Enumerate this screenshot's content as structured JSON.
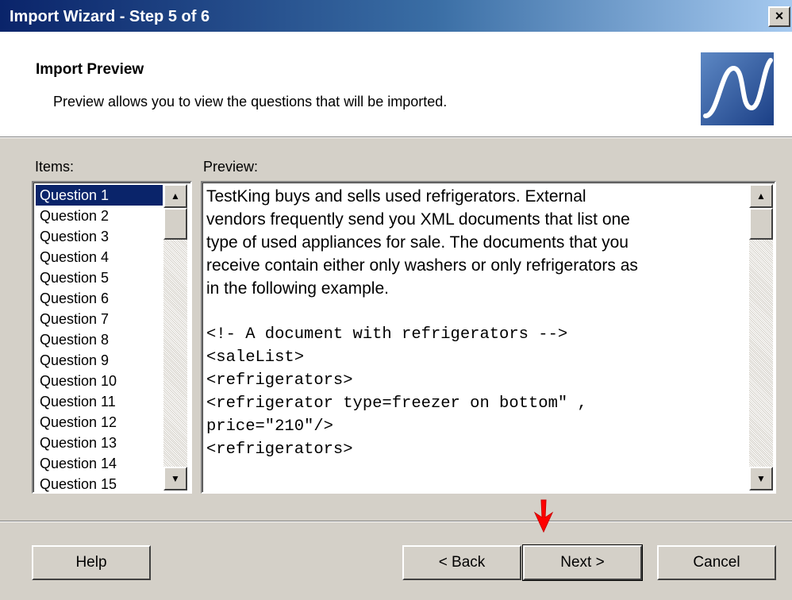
{
  "window": {
    "title": "Import Wizard - Step 5 of 6",
    "close_glyph": "×"
  },
  "header": {
    "title": "Import Preview",
    "subtitle": "Preview allows you to view the questions that will be imported.",
    "logo_icon": "wave-logo-icon"
  },
  "items": {
    "label": "Items:",
    "list": [
      "Question 1",
      "Question 2",
      "Question 3",
      "Question 4",
      "Question 5",
      "Question 6",
      "Question 7",
      "Question 8",
      "Question 9",
      "Question 10",
      "Question 11",
      "Question 12",
      "Question 13",
      "Question 14",
      "Question 15"
    ],
    "selected": "Question 1"
  },
  "preview": {
    "label": "Preview:",
    "paragraph_lines": [
      "TestKing buys and sells used refrigerators. External",
      "vendors frequently send you XML documents that list one",
      "type of used appliances for sale. The documents that you",
      "receive contain either only washers or only refrigerators as",
      "in the following example."
    ],
    "code_lines": [
      "<!- A document with refrigerators -->",
      "<saleList>",
      "<refrigerators>",
      "<refrigerator type=freezer on bottom″ ,",
      "price=″210″/>",
      "<refrigerators>"
    ]
  },
  "scroll_icons": {
    "up": "scroll-up-arrow-icon",
    "down": "scroll-down-arrow-icon"
  },
  "buttons": {
    "help": "Help",
    "back": "< Back",
    "next": "Next >",
    "cancel": "Cancel"
  },
  "annotation": {
    "icon": "red-down-arrow-icon",
    "color": "#ff0000"
  },
  "colors": {
    "title_bar_start": "#0a246a",
    "title_bar_end": "#a6caf0",
    "selection": "#0a246a",
    "face": "#d4d0c8"
  }
}
